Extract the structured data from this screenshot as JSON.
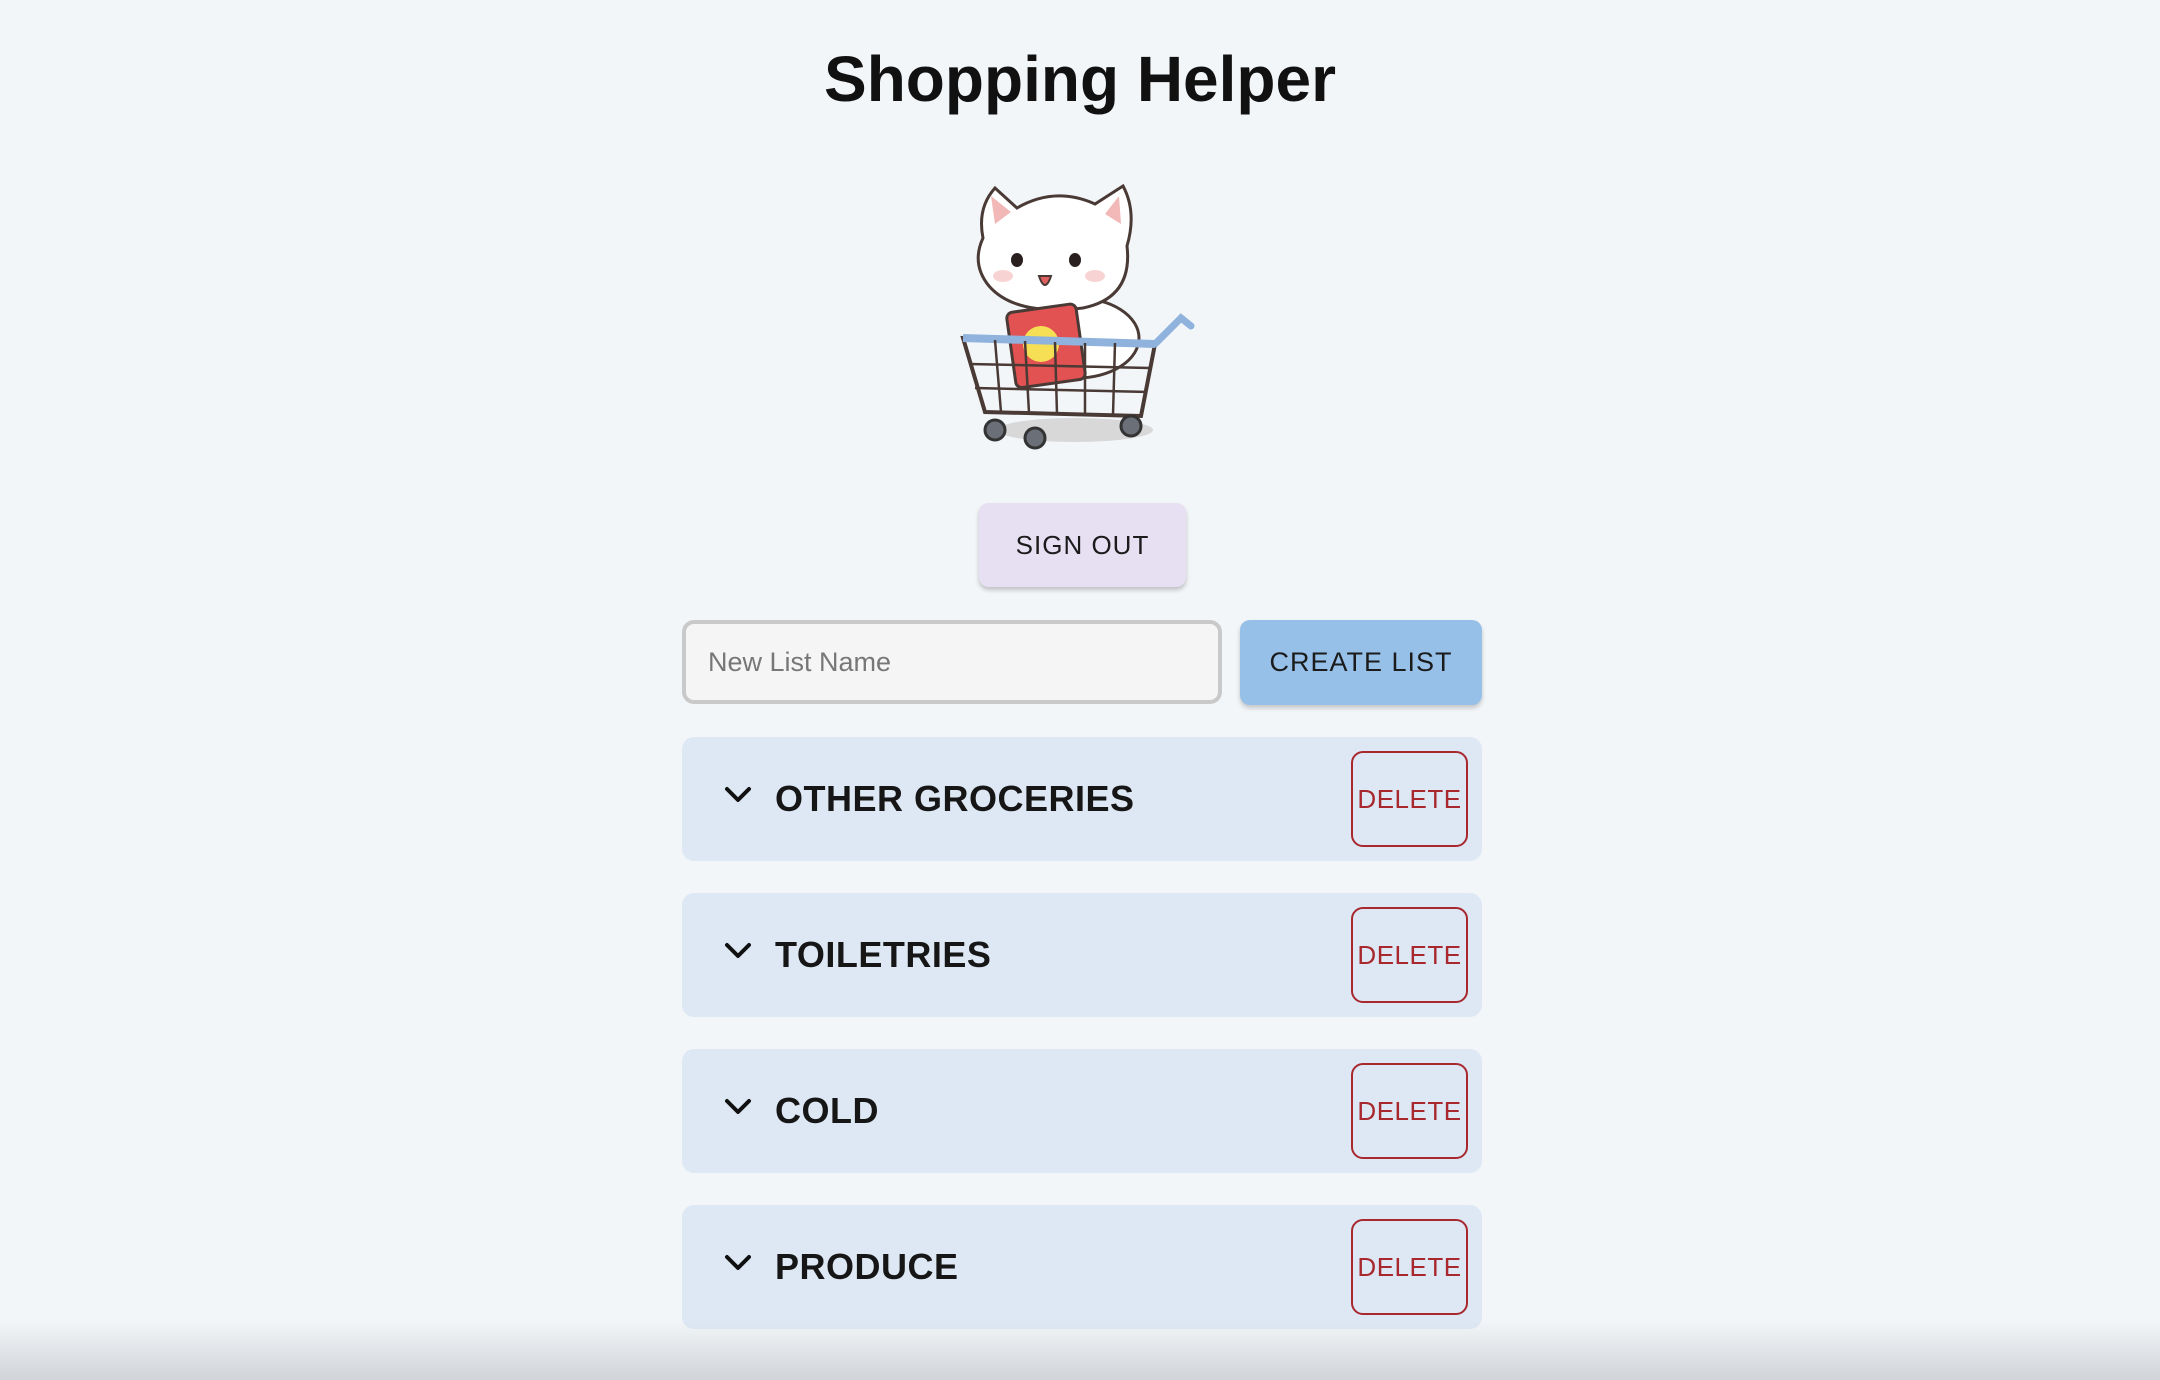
{
  "app": {
    "title": "Shopping Helper"
  },
  "mascot": {
    "description_icon": "cat-in-shopping-cart-icon"
  },
  "auth": {
    "sign_out_label": "SIGN OUT"
  },
  "new_list": {
    "placeholder": "New List Name",
    "value": "",
    "create_label": "CREATE LIST"
  },
  "lists": [
    {
      "name": "OTHER GROCERIES",
      "delete_label": "DELETE"
    },
    {
      "name": "TOILETRIES",
      "delete_label": "DELETE"
    },
    {
      "name": "COLD",
      "delete_label": "DELETE"
    },
    {
      "name": "PRODUCE",
      "delete_label": "DELETE"
    }
  ],
  "colors": {
    "background": "#f3f6f9",
    "sign_out_bg": "#e7dff2",
    "create_bg": "#96c0e8",
    "card_bg": "#dde8f4",
    "delete_red": "#a8282e"
  },
  "icons": {
    "expand": "chevron-down-icon"
  }
}
